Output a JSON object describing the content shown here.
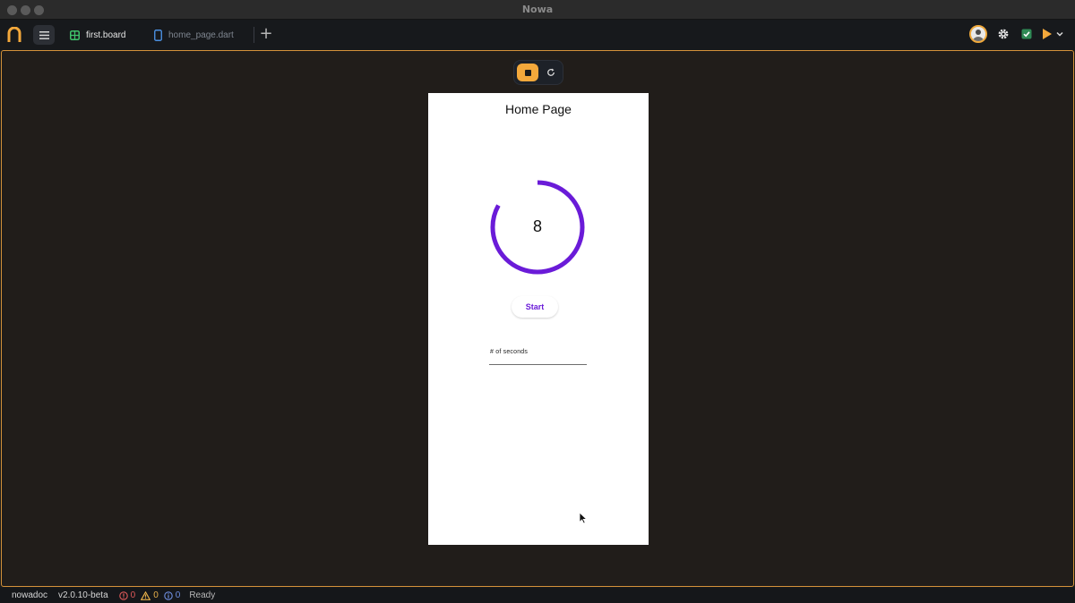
{
  "window": {
    "title": "Nowa"
  },
  "toolbar": {
    "tabs": [
      {
        "label": "first.board",
        "active": true
      },
      {
        "label": "home_page.dart",
        "active": false
      }
    ]
  },
  "preview": {
    "page_title": "Home Page",
    "countdown_value": "8",
    "progress_fraction": 0.83,
    "start_label": "Start",
    "seconds_field_label": "# of seconds"
  },
  "statusbar": {
    "project": "nowadoc",
    "version": "v2.0.10-beta",
    "errors": "0",
    "warnings": "0",
    "infos": "0",
    "state": "Ready"
  },
  "colors": {
    "accent": "#f3a83b",
    "progress": "#6a1bd8",
    "canvas_bg": "#211d1a"
  }
}
